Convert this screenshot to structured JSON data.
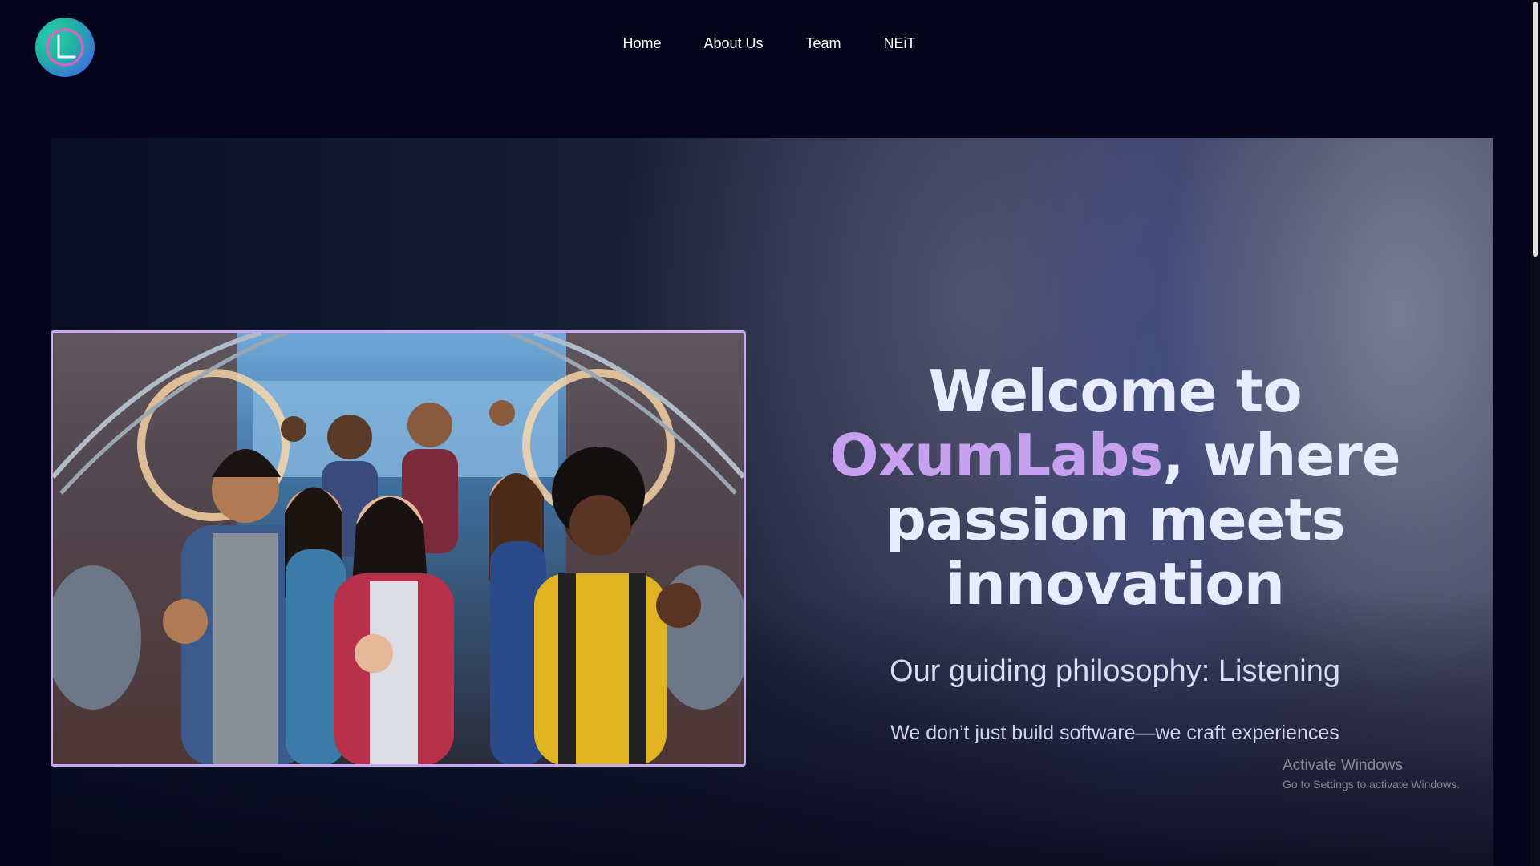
{
  "header": {
    "logo_icon": "oxumlabs-logo",
    "nav": [
      {
        "label": "Home"
      },
      {
        "label": "About Us"
      },
      {
        "label": "Team"
      },
      {
        "label": "NEiT"
      }
    ]
  },
  "hero": {
    "headline_prefix": "Welcome to",
    "brand": "OxumLabs",
    "headline_suffix": ", where passion meets innovation",
    "philosophy": "Our guiding philosophy:  Listening",
    "tagline": "We don’t just build software—we craft experiences",
    "image": "group photo of young people giving thumbs up in a futuristic lab"
  },
  "watermark": {
    "title": "Activate Windows",
    "subtitle": "Go to Settings to activate Windows."
  },
  "colors": {
    "background": "#04041a",
    "brand_accent": "#c8a0f0",
    "frame_border": "#c8a8f4",
    "headline": "#e8ecff"
  }
}
